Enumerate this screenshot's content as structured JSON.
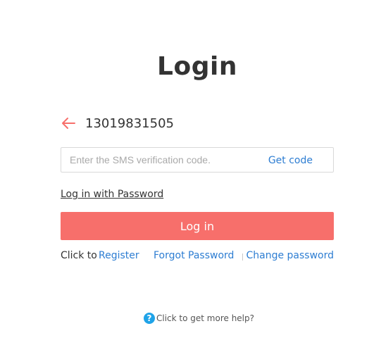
{
  "title": "Login",
  "phone": {
    "back_icon": "arrow-left-icon",
    "number": "13019831505"
  },
  "sms": {
    "placeholder": "Enter the SMS verification code.",
    "value": "",
    "get_code_label": "Get code"
  },
  "password_login_label": "Log in with Password",
  "login_button_label": "Log in",
  "links": {
    "click_to": "Click to",
    "register": "Register",
    "forgot_password": "Forgot Password",
    "change_password": "Change password"
  },
  "help": {
    "icon": "question-circle-icon",
    "glyph": "?",
    "text": "Click to get more help?"
  },
  "colors": {
    "accent": "#f76f6b",
    "link": "#2d7dd2",
    "help_icon": "#1fa3e8"
  }
}
